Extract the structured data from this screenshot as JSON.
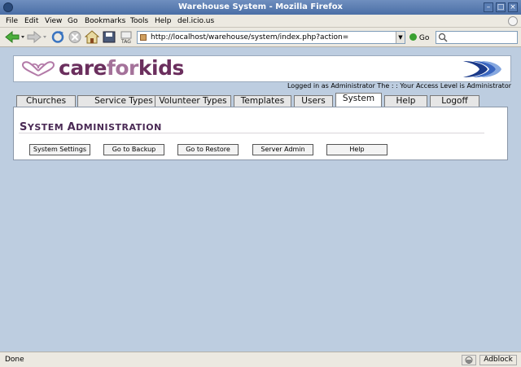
{
  "window": {
    "title": "Warehouse System - Mozilla Firefox",
    "minimize": "–",
    "maximize": "□",
    "close": "×"
  },
  "menu": {
    "items": [
      "File",
      "Edit",
      "View",
      "Go",
      "Bookmarks",
      "Tools",
      "Help",
      "del.icio.us"
    ]
  },
  "nav": {
    "url": "http://localhost/warehouse/system/index.php?action=",
    "go_label": "Go",
    "dropdown_glyph": "▼"
  },
  "brand": {
    "logo_part1": "care",
    "logo_part2": "for",
    "logo_part3": "kids",
    "logo_color": "#6b2f5e",
    "logo_light_color": "#a4729a"
  },
  "login": {
    "text": "Logged in as Administrator The  :  :  Your Access Level is Administrator"
  },
  "tabs": [
    {
      "label": "Churches",
      "active": false
    },
    {
      "label": "Service Types",
      "active": false
    },
    {
      "label": "Volunteer Types",
      "active": false
    },
    {
      "label": "Templates",
      "active": false
    },
    {
      "label": "Users",
      "active": false
    },
    {
      "label": "System",
      "active": true
    },
    {
      "label": "Help",
      "active": false
    },
    {
      "label": "Logoff",
      "active": false
    }
  ],
  "panel": {
    "title_initial_1": "S",
    "title_rest_1": "YSTEM ",
    "title_initial_2": "A",
    "title_rest_2": "DMINISTRATION",
    "buttons": [
      {
        "label": "System Settings"
      },
      {
        "label": "Go to Backup"
      },
      {
        "label": "Go to Restore"
      },
      {
        "label": "Server Admin"
      },
      {
        "label": "Help"
      }
    ]
  },
  "status": {
    "text": "Done",
    "adblock": "Adblock"
  }
}
